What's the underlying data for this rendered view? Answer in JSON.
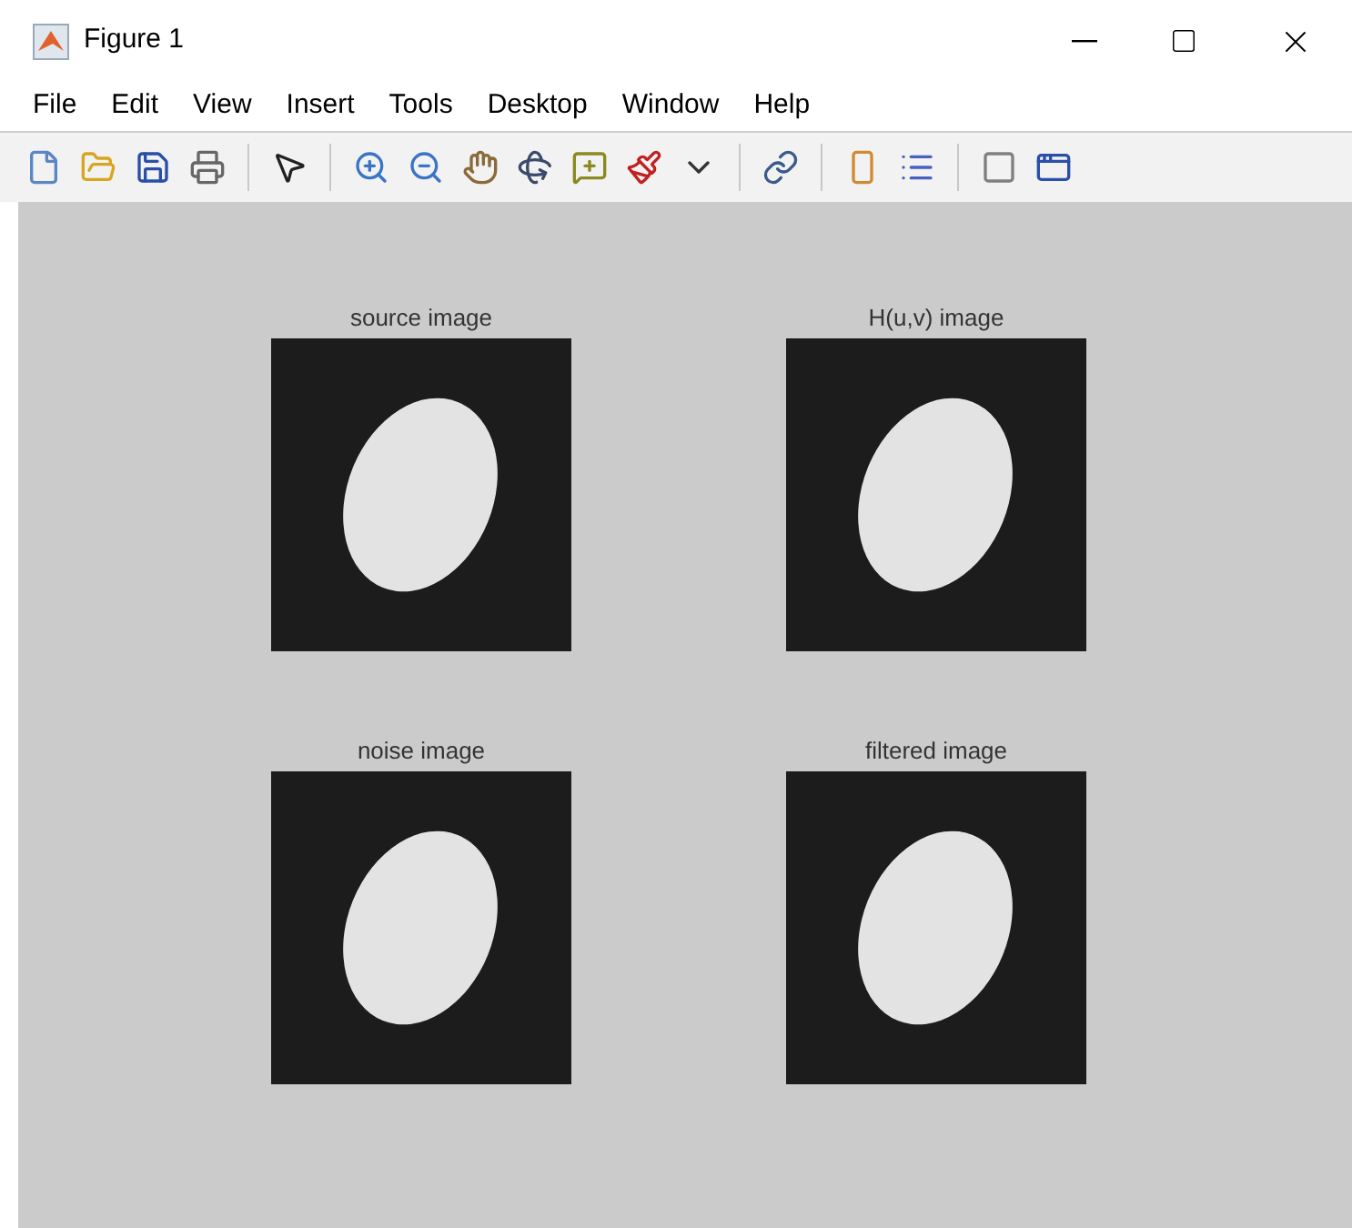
{
  "window": {
    "title": "Figure 1"
  },
  "menu": [
    "File",
    "Edit",
    "View",
    "Insert",
    "Tools",
    "Desktop",
    "Window",
    "Help"
  ],
  "axes": [
    {
      "title": "source image",
      "kind": "picture"
    },
    {
      "title": "H(u,v) image",
      "kind": "picture"
    },
    {
      "title": "noise image",
      "kind": "picture"
    },
    {
      "title": "filtered image",
      "kind": "picture"
    }
  ]
}
